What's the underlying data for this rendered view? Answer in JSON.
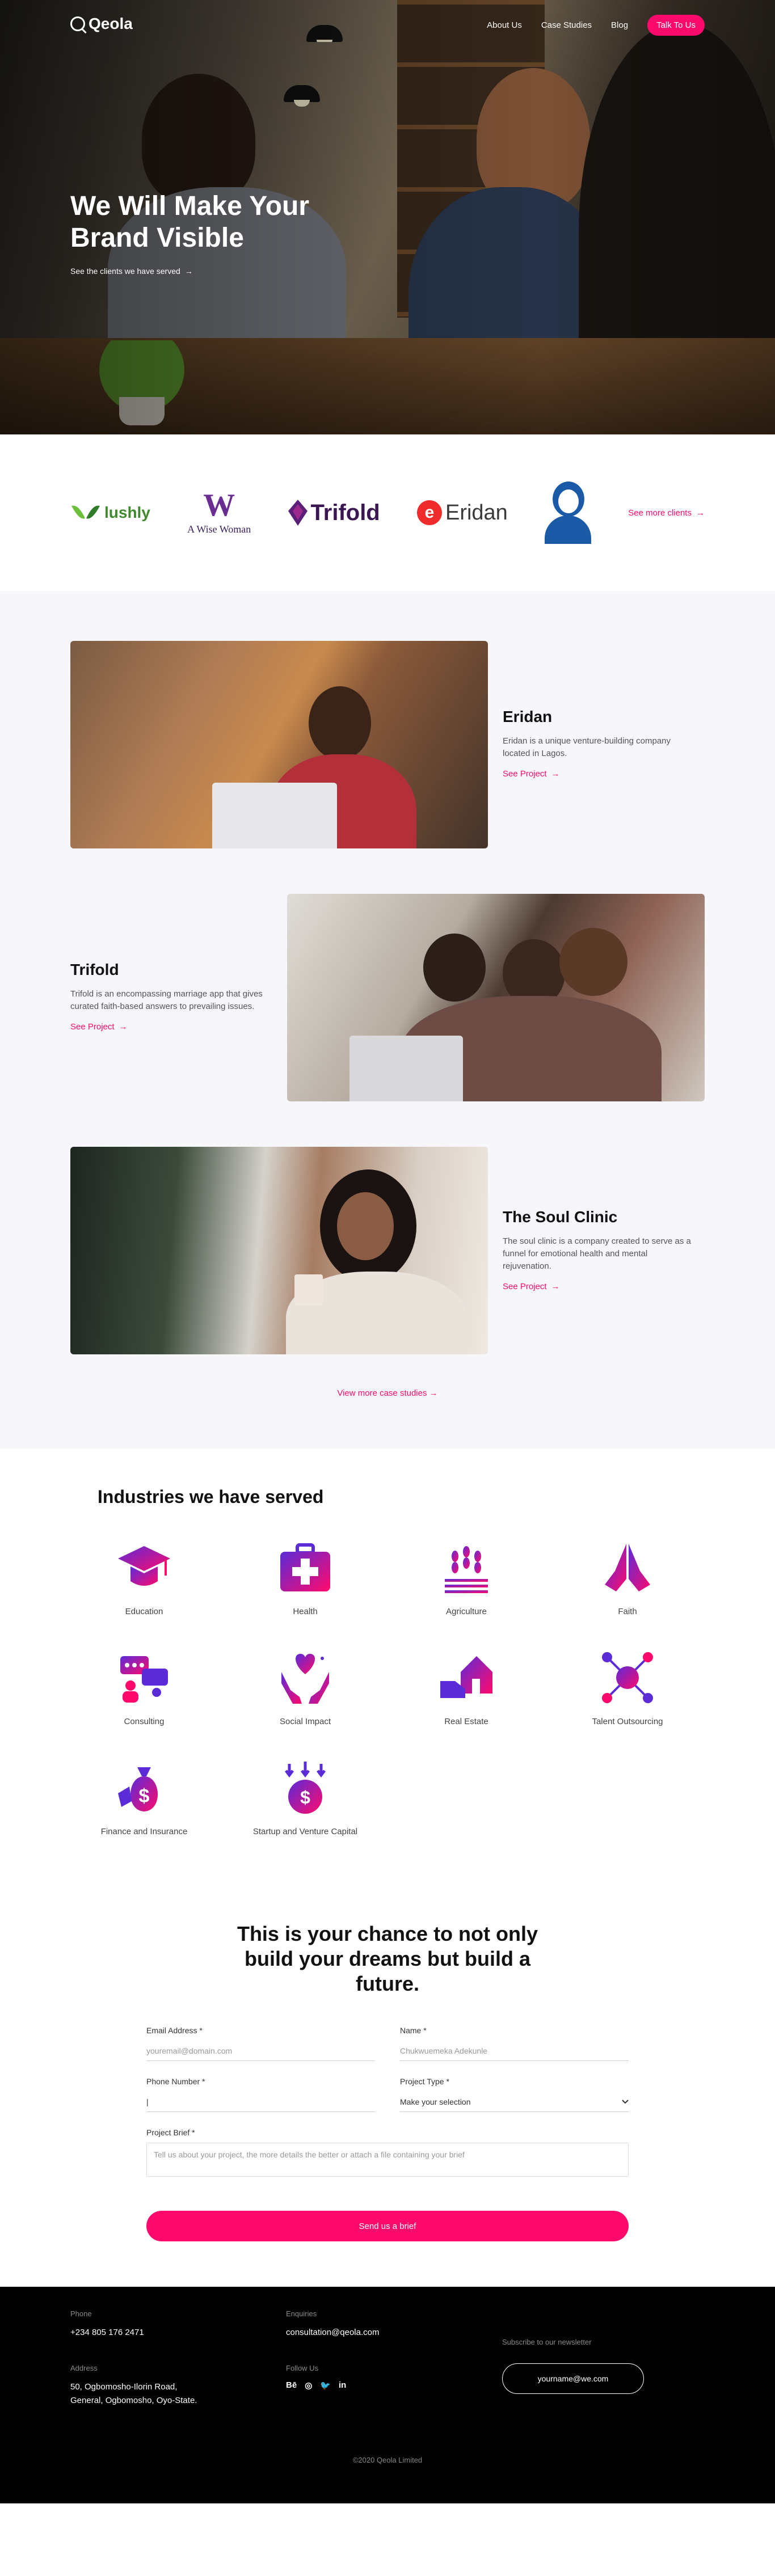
{
  "nav": {
    "logo": "Qeola",
    "about": "About Us",
    "case_studies": "Case Studies",
    "blog": "Blog",
    "cta": "Talk To Us"
  },
  "hero": {
    "title": "We Will Make Your Brand Visible",
    "subtitle": "See the clients we have served",
    "arrow": "→"
  },
  "clients": {
    "lushly": "lushly",
    "wise_line1": "W",
    "wise_line2": "A Wise Woman",
    "trifold": "Trifold",
    "eridan": "Eridan",
    "see_more": "See more clients",
    "arrow": "→"
  },
  "cases": [
    {
      "title": "Eridan",
      "desc": "Eridan is a unique venture-building company located in Lagos.",
      "link": "See Project"
    },
    {
      "title": "Trifold",
      "desc": "Trifold is an encompassing marriage app that gives curated faith-based answers to prevailing issues.",
      "link": "See Project"
    },
    {
      "title": "The Soul Clinic",
      "desc": "The soul clinic is a company created to serve as a funnel for emotional health and mental rejuvenation.",
      "link": "See Project"
    }
  ],
  "cases_view_more": "View more case studies",
  "arrow": "→",
  "industries": {
    "title": "Industries we have served",
    "items": [
      "Education",
      "Health",
      "Agriculture",
      "Faith",
      "Consulting",
      "Social Impact",
      "Real Estate",
      "Talent Outsourcing",
      "Finance and Insurance",
      "Startup and Venture Capital"
    ]
  },
  "contact": {
    "title": "This is your chance to not only build your dreams but build a future.",
    "email_label": "Email Address *",
    "email_placeholder": "youremail@domain.com",
    "name_label": "Name *",
    "name_placeholder": "Chukwuemeka Adekunle",
    "phone_label": "Phone Number *",
    "phone_value": "|",
    "type_label": "Project Type *",
    "type_value": "Make your selection",
    "brief_label": "Project Brief *",
    "brief_placeholder": "Tell us about your project, the more details the better or attach a file containing your brief",
    "submit": "Send us a brief"
  },
  "footer": {
    "phone_label": "Phone",
    "phone": "+234 805 176 2471",
    "enquiries_label": "Enquiries",
    "email": "consultation@qeola.com",
    "address_label": "Address",
    "address_line1": "50, Ogbomosho-Ilorin Road,",
    "address_line2": "General, Ogbomosho, Oyo-State.",
    "follow_label": "Follow Us",
    "social_behance": "Bē",
    "social_dribbble": "◎",
    "social_twitter": "🐦",
    "social_linkedin": "in",
    "newsletter_label": "Subscribe to our newsletter",
    "newsletter_placeholder": "yourname@we.com",
    "copyright": "©2020 Qeola Limited"
  },
  "colors": {
    "accent": "#ff0a6c",
    "footer_bg": "#000000",
    "section_bg": "#f6f6fb"
  }
}
